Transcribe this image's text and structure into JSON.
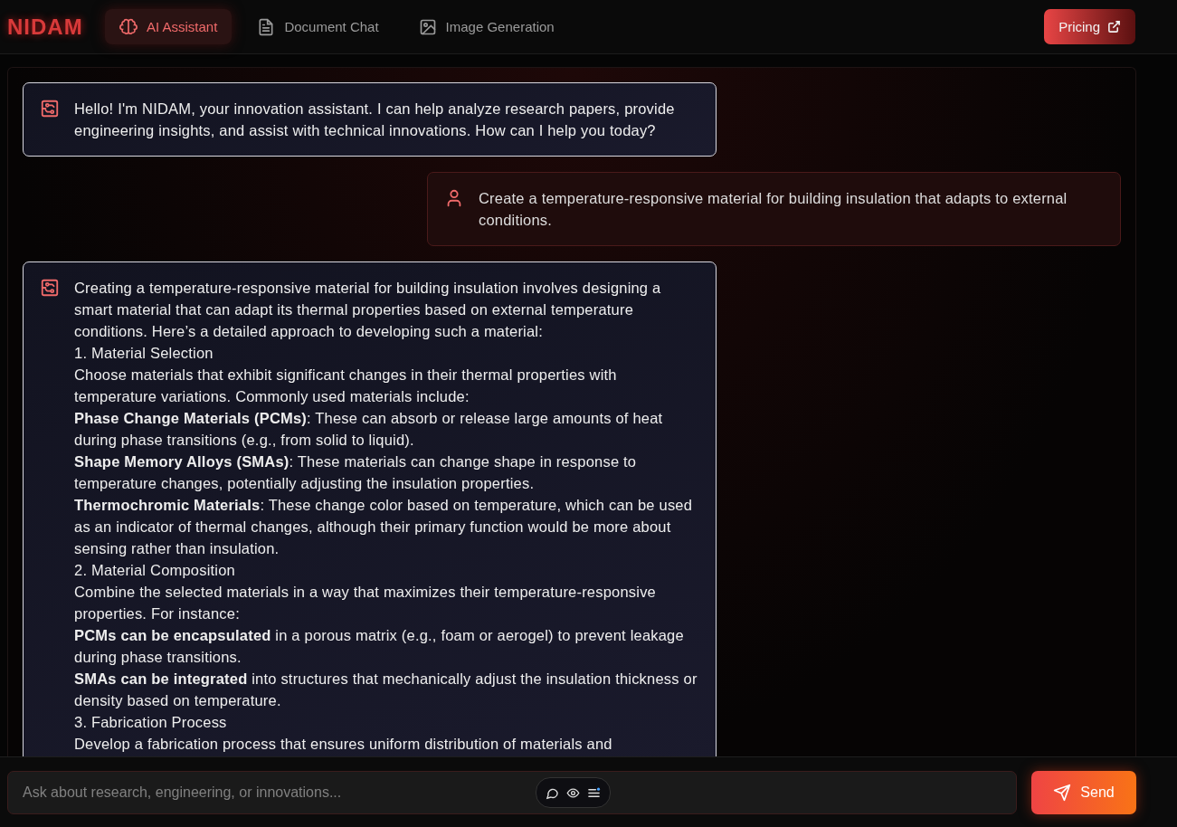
{
  "brand": "NIDAM",
  "tabs": [
    {
      "label": "AI Assistant",
      "kind": "brain",
      "selected": true
    },
    {
      "label": "Document Chat",
      "kind": "document",
      "selected": false
    },
    {
      "label": "Image Generation",
      "kind": "image",
      "selected": false
    }
  ],
  "pricing": {
    "label": "Pricing"
  },
  "messages": [
    {
      "kind": "assistant",
      "lines": [
        "Hello! I'm NIDAM, your innovation assistant. I can help analyze research papers, provide engineering insights, and assist with technical innovations. How can I help you today?"
      ]
    },
    {
      "kind": "user",
      "lines": [
        "Create a temperature-responsive material for building insulation that adapts to external conditions."
      ]
    },
    {
      "kind": "assistant",
      "lines": [
        "Creating a temperature-responsive material for building insulation involves designing a smart material that can adapt its thermal properties based on external temperature conditions. Here’s a detailed approach to developing such a material:",
        "1. Material Selection",
        "Choose materials that exhibit significant changes in their thermal properties with temperature variations. Commonly used materials include:",
        "**Phase Change Materials (PCMs)**: These can absorb or release large amounts of heat during phase transitions (e.g., from solid to liquid).",
        "**Shape Memory Alloys (SMAs)**: These materials can change shape in response to temperature changes, potentially adjusting the insulation properties.",
        "**Thermochromic Materials**: These change color based on temperature, which can be used as an indicator of thermal changes, although their primary function would be more about sensing rather than insulation.",
        "2. Material Composition",
        "Combine the selected materials in a way that maximizes their temperature-responsive properties. For instance:",
        "**PCMs can be encapsulated** in a porous matrix (e.g., foam or aerogel) to prevent leakage during phase transitions.",
        "**SMAs can be integrated** into structures that mechanically adjust the insulation thickness or density based on temperature.",
        "3. Fabrication Process",
        "Develop a fabrication process that ensures uniform distribution of materials and"
      ]
    }
  ],
  "composer": {
    "placeholder": "Ask about research, engineering, or innovations...",
    "send": "Send"
  }
}
